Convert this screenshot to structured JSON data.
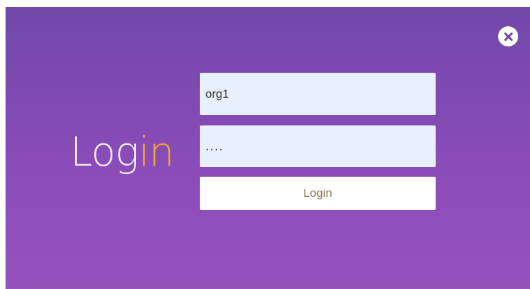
{
  "colors": {
    "background_top": "#7148a9",
    "background_bottom": "#9752bc",
    "title_primary": "#f1ecf7",
    "title_accent": "#f0a72c",
    "input_background": "#e8effd",
    "button_text": "#8b7a5c"
  },
  "header": {
    "close_icon": "close-icon"
  },
  "title": {
    "part1": "Log",
    "part2": "in"
  },
  "form": {
    "username_value": "org1",
    "password_value": "....",
    "submit_label": "Login"
  }
}
